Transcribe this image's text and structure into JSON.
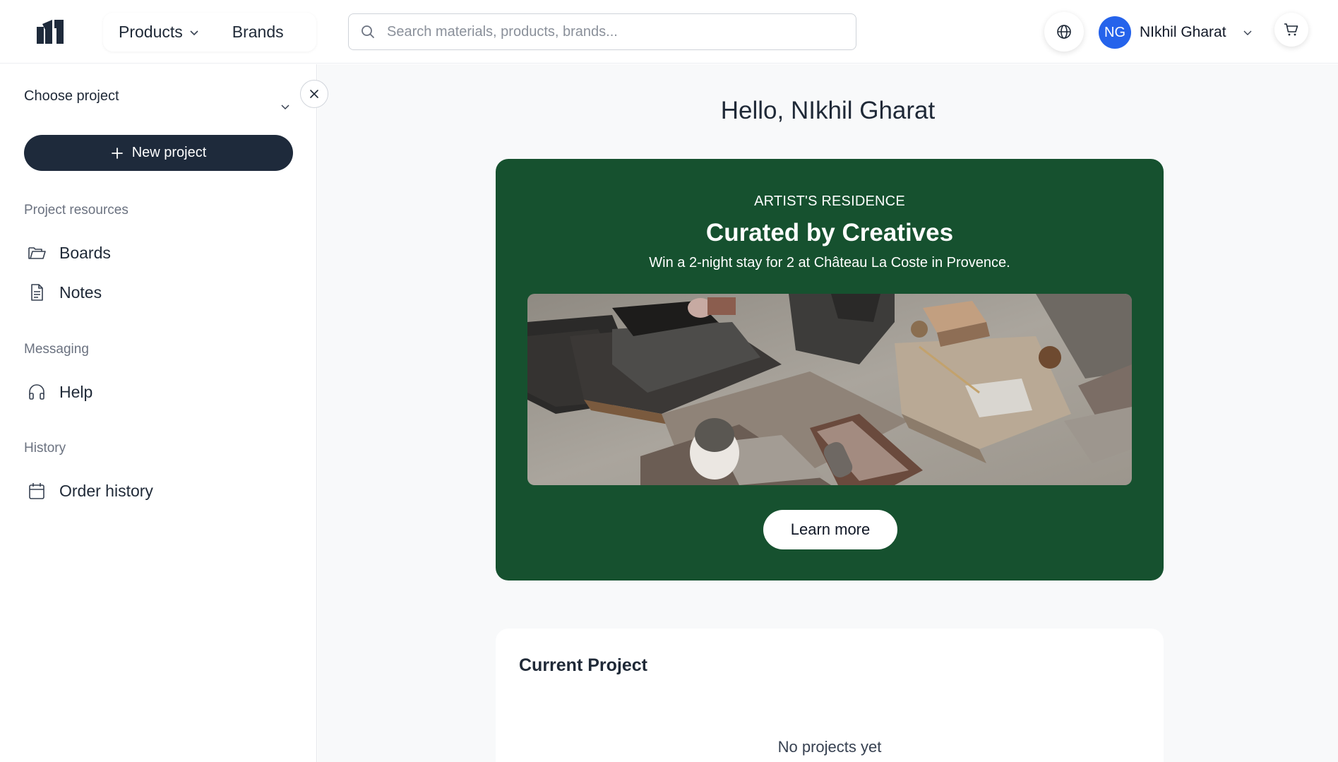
{
  "header": {
    "nav": {
      "products_label": "Products",
      "brands_label": "Brands"
    },
    "search": {
      "placeholder": "Search materials, products, brands..."
    },
    "user": {
      "initials": "NG",
      "name": "NIkhil Gharat"
    },
    "icons": [
      "logo",
      "search-icon",
      "globe-icon",
      "chevron-down-icon",
      "cart-icon"
    ]
  },
  "sidebar": {
    "choose_project_label": "Choose project",
    "new_project_label": "New project",
    "sections": {
      "resources_label": "Project resources",
      "messaging_label": "Messaging",
      "history_label": "History"
    },
    "items": {
      "boards": "Boards",
      "notes": "Notes",
      "help": "Help",
      "order_history": "Order history"
    }
  },
  "main": {
    "greeting": "Hello, NIkhil Gharat",
    "promo": {
      "eyebrow": "ARTIST'S RESIDENCE",
      "title": "Curated by Creatives",
      "subtitle": "Win a 2-night stay for 2 at Château La Coste in Provence.",
      "cta": "Learn more",
      "background_color": "#16512f"
    },
    "current_project": {
      "title": "Current Project",
      "empty_text": "No projects yet"
    }
  },
  "colors": {
    "primary_dark": "#1e2a3b",
    "avatar_blue": "#2563eb",
    "promo_green": "#16512f"
  }
}
